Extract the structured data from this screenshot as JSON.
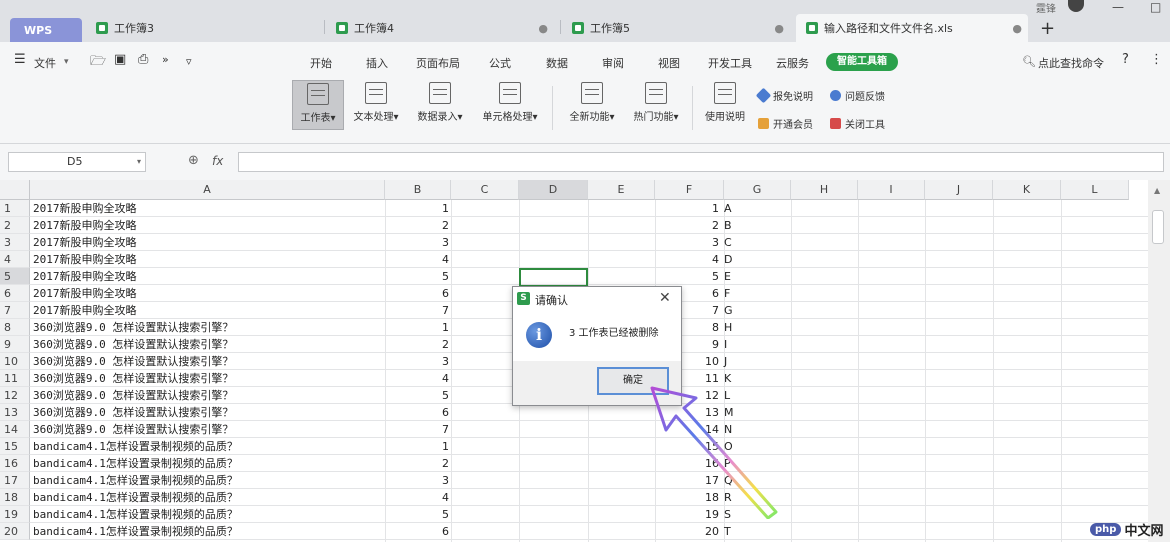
{
  "tabs": [
    {
      "label": "WPS"
    },
    {
      "label": "工作簿3",
      "close": ""
    },
    {
      "label": "工作簿4",
      "close": "●"
    },
    {
      "label": "工作簿5",
      "close": "●"
    },
    {
      "label": "输入路径和文件文件名.xls",
      "close": "●"
    }
  ],
  "titlebar": {
    "plus": "+",
    "user_text": "霆锋",
    "minimize": "—",
    "maximize": "□"
  },
  "menu": {
    "file_label": "文件",
    "items": [
      "开始",
      "插入",
      "页面布局",
      "公式",
      "数据",
      "审阅",
      "视图",
      "开发工具",
      "云服务"
    ],
    "smart_tool": "智能工具箱",
    "search_text": "点此查找命令",
    "help": "?",
    "more": "⋮",
    "more_arrows": "»",
    "quick_more": "▿"
  },
  "ribbon": {
    "buttons": [
      "工作表",
      "文本处理",
      "数据录入",
      "单元格处理",
      "全新功能",
      "热门功能",
      "使用说明"
    ],
    "small": [
      "报免说明",
      "问题反馈",
      "开通会员",
      "关闭工具"
    ]
  },
  "formula": {
    "cell_ref": "D5",
    "fx": "fx"
  },
  "columns": [
    "A",
    "B",
    "C",
    "D",
    "E",
    "F",
    "G",
    "H",
    "I",
    "J",
    "K",
    "L"
  ],
  "rows": [
    {
      "n": "1",
      "a": "2017新股申购全攻略",
      "b": "1",
      "f": "1",
      "g": "A"
    },
    {
      "n": "2",
      "a": "2017新股申购全攻略",
      "b": "2",
      "f": "2",
      "g": "B"
    },
    {
      "n": "3",
      "a": "2017新股申购全攻略",
      "b": "3",
      "f": "3",
      "g": "C"
    },
    {
      "n": "4",
      "a": "2017新股申购全攻略",
      "b": "4",
      "f": "4",
      "g": "D"
    },
    {
      "n": "5",
      "a": "2017新股申购全攻略",
      "b": "5",
      "f": "5",
      "g": "E"
    },
    {
      "n": "6",
      "a": "2017新股申购全攻略",
      "b": "6",
      "f": "6",
      "g": "F"
    },
    {
      "n": "7",
      "a": "2017新股申购全攻略",
      "b": "7",
      "f": "7",
      "g": "G"
    },
    {
      "n": "8",
      "a": "360浏览器9.0 怎样设置默认搜索引擎？",
      "b": "1",
      "f": "8",
      "g": "H"
    },
    {
      "n": "9",
      "a": "360浏览器9.0 怎样设置默认搜索引擎？",
      "b": "2",
      "f": "9",
      "g": "I"
    },
    {
      "n": "10",
      "a": "360浏览器9.0 怎样设置默认搜索引擎？",
      "b": "3",
      "f": "10",
      "g": "J"
    },
    {
      "n": "11",
      "a": "360浏览器9.0 怎样设置默认搜索引擎？",
      "b": "4",
      "f": "11",
      "g": "K"
    },
    {
      "n": "12",
      "a": "360浏览器9.0 怎样设置默认搜索引擎？",
      "b": "5",
      "f": "12",
      "g": "L"
    },
    {
      "n": "13",
      "a": "360浏览器9.0 怎样设置默认搜索引擎？",
      "b": "6",
      "f": "13",
      "g": "M"
    },
    {
      "n": "14",
      "a": "360浏览器9.0 怎样设置默认搜索引擎？",
      "b": "7",
      "f": "14",
      "g": "N"
    },
    {
      "n": "15",
      "a": "bandicam4.1怎样设置录制视频的品质？",
      "b": "1",
      "f": "15",
      "g": "O"
    },
    {
      "n": "16",
      "a": "bandicam4.1怎样设置录制视频的品质？",
      "b": "2",
      "f": "16",
      "g": "P"
    },
    {
      "n": "17",
      "a": "bandicam4.1怎样设置录制视频的品质？",
      "b": "3",
      "f": "17",
      "g": "Q"
    },
    {
      "n": "18",
      "a": "bandicam4.1怎样设置录制视频的品质？",
      "b": "4",
      "f": "18",
      "g": "R"
    },
    {
      "n": "19",
      "a": "bandicam4.1怎样设置录制视频的品质？",
      "b": "5",
      "f": "19",
      "g": "S"
    },
    {
      "n": "20",
      "a": "bandicam4.1怎样设置录制视频的品质？",
      "b": "6",
      "f": "20",
      "g": "T"
    }
  ],
  "dialog": {
    "title": "请确认",
    "message": "3 工作表已经被删除",
    "ok": "确定",
    "info_glyph": "i",
    "logo": "S",
    "close": "✕"
  },
  "watermark": {
    "logo": "php",
    "text": "中文网"
  },
  "colors": {
    "accent_green": "#2e8b3e",
    "wps_tab": "#8a94d8",
    "smart_green": "#2ba14c",
    "dialog_focus": "#5b8fd6"
  }
}
